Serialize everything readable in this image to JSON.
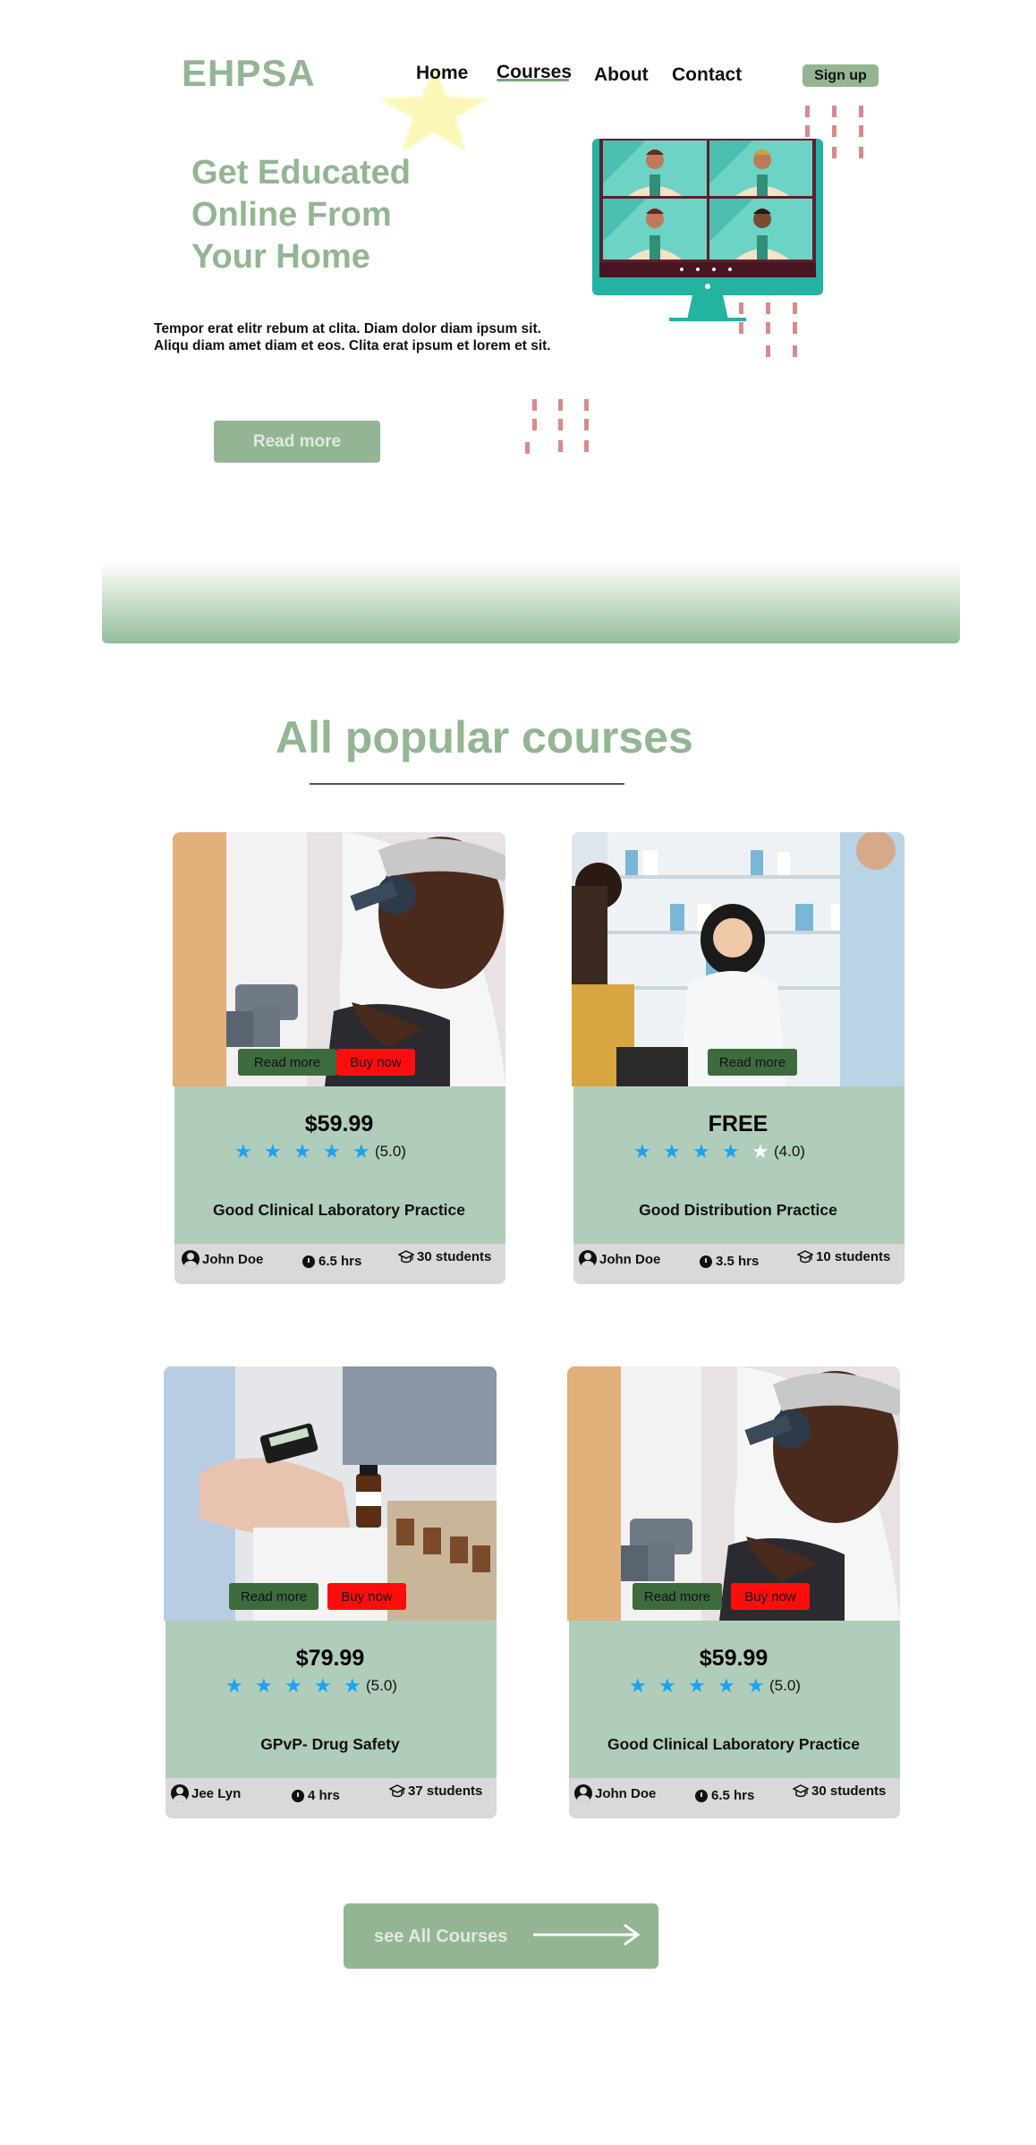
{
  "header": {
    "logo": "EHPSA",
    "nav": [
      "Home",
      "Courses",
      "About",
      "Contact"
    ],
    "signup_label": "Sign up"
  },
  "hero": {
    "title_lines": [
      "Get Educated",
      "Online From",
      "Your Home"
    ],
    "text": "Tempor erat elitr rebum at clita. Diam dolor diam ipsum sit. Aliqu diam amet diam et eos. Clita erat ipsum et lorem et sit.",
    "read_more_label": "Read more"
  },
  "popular": {
    "title": "All popular courses"
  },
  "courses": [
    {
      "price": "$59.99",
      "rating": "(5.0)",
      "stars_filled": 5,
      "title": "Good Clinical Laboratory Practice",
      "author": "John Doe",
      "duration": "6.5 hrs",
      "students": "30 students",
      "read_more_label": "Read more",
      "buy_label": "Buy now",
      "has_buy": true,
      "image": "lab-microscope-photo"
    },
    {
      "price": "FREE",
      "rating": "(4.0)",
      "stars_filled": 4,
      "title": "Good Distribution Practice",
      "author": "John Doe",
      "duration": "3.5 hrs",
      "students": "10 students",
      "read_more_label": "Read more",
      "has_buy": false,
      "image": "pharmacy-photo"
    },
    {
      "price": "$79.99",
      "rating": "(5.0)",
      "stars_filled": 5,
      "title": "GPvP- Drug Safety",
      "author": "Jee Lyn",
      "duration": "4 hrs",
      "students": "37 students",
      "read_more_label": "Read more",
      "buy_label": "Buy now",
      "has_buy": true,
      "image": "calculator-medicine-photo"
    },
    {
      "price": "$59.99",
      "rating": "(5.0)",
      "stars_filled": 5,
      "title": "Good Clinical Laboratory Practice",
      "author": "John Doe",
      "duration": "6.5 hrs",
      "students": "30 students",
      "read_more_label": "Read more",
      "buy_label": "Buy now",
      "has_buy": true,
      "image": "lab-microscope-photo"
    }
  ],
  "see_all": {
    "label": "see All Courses"
  },
  "colors": {
    "accent_green": "#93b593",
    "card_body": "#b0ccba",
    "read_button": "#3e6b3e",
    "buy_button": "#ff0d0d",
    "star_blue": "#1aa3f0",
    "decor_dash": "#d98a8a"
  }
}
